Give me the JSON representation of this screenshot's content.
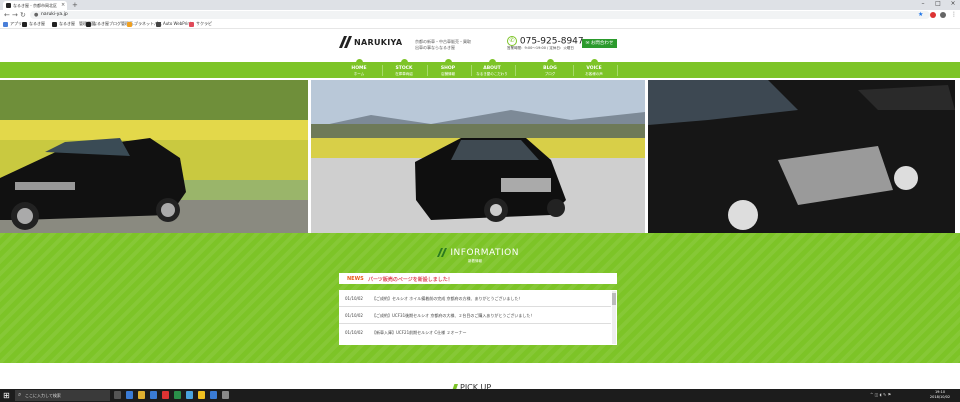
{
  "browser": {
    "tab_title": "なるき屋 - 京都市岡北区中古車販...",
    "url": "naruki-ya.jp",
    "bookmarks": [
      "アプリ",
      "なるき屋",
      "なるき屋　管理画面",
      "なるき屋ブログ管理画...",
      "ブラネットパス",
      "Auto WebPrint",
      "サクラピ"
    ]
  },
  "site": {
    "logo_text": "NARUKIYA",
    "tagline": "京都の新車・中古車販売・買取\n出車の事ならなるき屋",
    "phone": "075-925-8947",
    "hours": "営業時間：9:00～19:00 / 定休日：火曜日",
    "contact_label": "お問合わせ",
    "nav": [
      {
        "en": "HOME",
        "jp": "ホーム"
      },
      {
        "en": "STOCK",
        "jp": "在庫車両紹"
      },
      {
        "en": "SHOP",
        "jp": "店舗情報"
      },
      {
        "en": "ABOUT",
        "jp": "なるき屋のこだわり"
      },
      {
        "en": "BLOG",
        "jp": "ブログ"
      },
      {
        "en": "VOICE",
        "jp": "お客様の声"
      }
    ]
  },
  "information": {
    "title": "INFORMATION",
    "subtitle": "新着情報",
    "news_label": "NEWS",
    "news_headline": "パーツ販売のページを新設しました！",
    "items": [
      {
        "date": "01/10/02",
        "text": "【ご成約】セルシオ ホイル備着前の完成 京都府の方様、ありがとうございました！"
      },
      {
        "date": "01/10/02",
        "text": "【ご成約】UCF31後期セルシオ 京都府の大様、２台目のご購入ありがとうございました！"
      },
      {
        "date": "01/10/02",
        "text": "【新車入庫】UCF21前期セルシオ C仕様 ２オーナー"
      }
    ]
  },
  "pickup": {
    "title": "PICK UP"
  },
  "taskbar": {
    "search_placeholder": "ここに入力して検索",
    "time": "19:10",
    "date": "2018/10/02"
  }
}
